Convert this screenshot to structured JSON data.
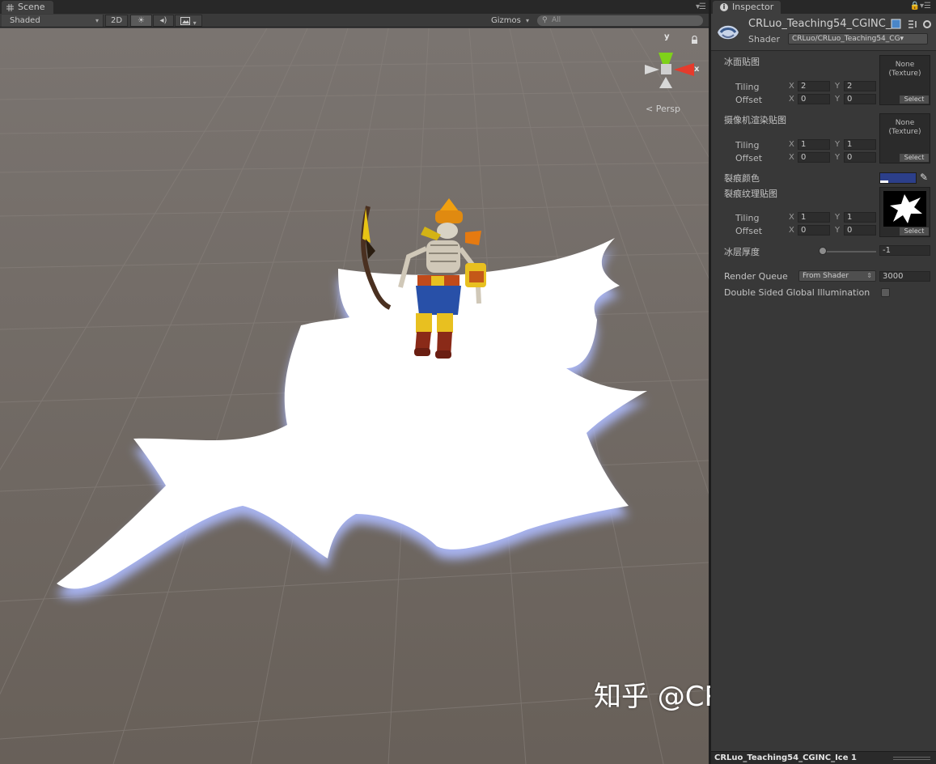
{
  "scene": {
    "tab_label": "Scene",
    "draw_mode": "Shaded",
    "btn_2d": "2D",
    "gizmos_label": "Gizmos",
    "search_placeholder": "All",
    "projection_label": "Persp",
    "axis_y": "y",
    "axis_x": "x",
    "icons": [
      "scene-grid-icon",
      "sun-icon",
      "audio-icon",
      "image-effects-icon",
      "search-icon",
      "lock-icon",
      "menu-icon"
    ]
  },
  "watermark": "知乎 @CRomputer罗老师",
  "inspector": {
    "tab_label": "Inspector",
    "material_name": "CRLuo_Teaching54_CGINC_",
    "shader_label": "Shader",
    "shader_value": "CRLuo/CRLuo_Teaching54_CG",
    "properties": {
      "tex1_label": "冰面贴图",
      "tex2_label": "摄像机渲染贴图",
      "crack_color_label": "裂痕颜色",
      "tex3_label": "裂痕纹理贴图",
      "ice_thickness_label": "冰层厚度",
      "tiling": "Tiling",
      "offset": "Offset",
      "x": "X",
      "y": "Y",
      "none_texture_1": "None",
      "none_texture_2": "(Texture)",
      "select": "Select",
      "tex1_tiling_x": "2",
      "tex1_tiling_y": "2",
      "tex1_offset_x": "0",
      "tex1_offset_y": "0",
      "tex2_tiling_x": "1",
      "tex2_tiling_y": "1",
      "tex2_offset_x": "0",
      "tex2_offset_y": "0",
      "tex3_tiling_x": "1",
      "tex3_tiling_y": "1",
      "tex3_offset_x": "0",
      "tex3_offset_y": "0",
      "ice_thickness_value": "-1",
      "crack_color": "#2c3f8a"
    },
    "render_queue_label": "Render Queue",
    "render_queue_mode": "From Shader",
    "render_queue_value": "3000",
    "double_sided_gi_label": "Double Sided Global Illumination",
    "preview_title": "CRLuo_Teaching54_CGINC_Ice 1"
  }
}
